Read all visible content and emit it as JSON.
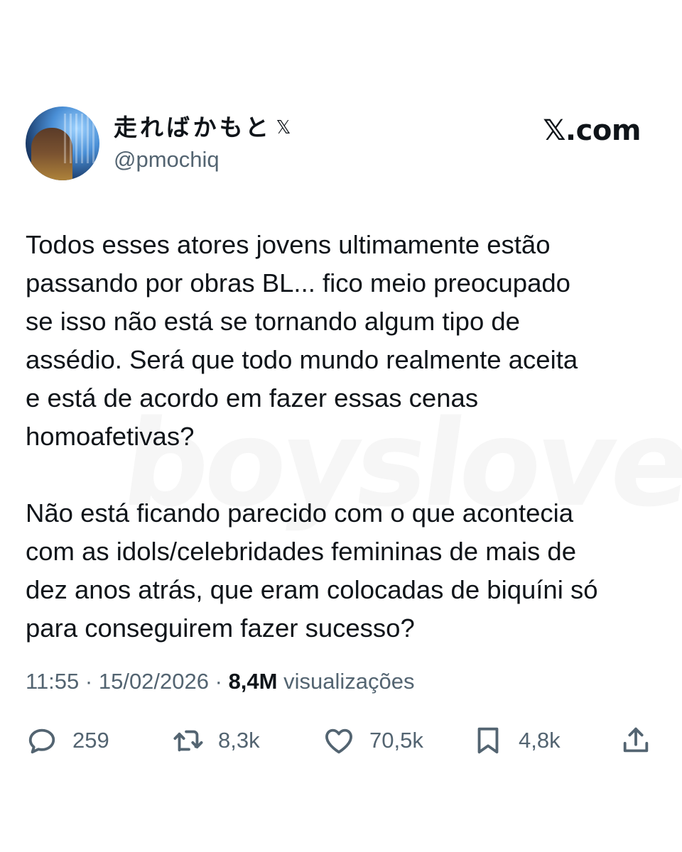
{
  "watermark": "boyslove",
  "author": {
    "display_name": "走ればかもと",
    "badge_icon": "x-logo-icon",
    "handle": "@pmochiq",
    "avatar_icon": "user-avatar"
  },
  "brand": "𝕏.com",
  "tweet": {
    "paragraphs": [
      "Todos esses atores jovens ultimamente estão\npassando por obras BL... fico meio preocupado\nse isso não está se tornando algum tipo de\nassédio. Será que todo mundo realmente aceita\ne está de acordo em fazer essas cenas\nhomoafetivas?",
      "Não está ficando parecido com o que acontecia\ncom as idols/celebridades femininas de mais de\ndez anos atrás, que eram colocadas de biquíni só\npara conseguirem fazer sucesso?"
    ]
  },
  "meta": {
    "time": "11:55",
    "separator": " · ",
    "date": "15/02/2026",
    "views_count": "8,4M",
    "views_label": " visualizações"
  },
  "actions": {
    "reply": {
      "icon": "reply-icon",
      "count": "259"
    },
    "repost": {
      "icon": "repost-icon",
      "count": "8,3k"
    },
    "like": {
      "icon": "heart-icon",
      "count": "70,5k"
    },
    "bookmark": {
      "icon": "bookmark-icon",
      "count": "4,8k"
    },
    "share": {
      "icon": "share-icon"
    }
  },
  "colors": {
    "text_primary": "#0f1419",
    "text_secondary": "#536471",
    "background": "#ffffff"
  }
}
